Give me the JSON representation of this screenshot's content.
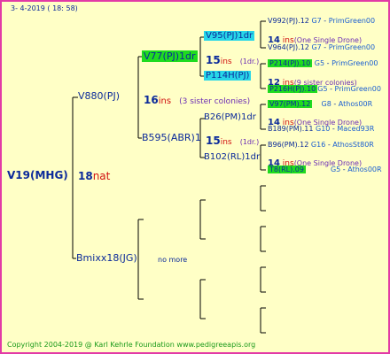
{
  "header": {
    "date": "3-  4-2019  ( 18: 58)"
  },
  "root": {
    "name": "V19(MHG)",
    "gen": "18",
    "unit": "nat"
  },
  "gen1": {
    "sire": "V880(PJ)",
    "sire_gen": "16",
    "sire_unit": "ins",
    "sire_note": "(3 sister colonies)",
    "dam": "Bmixx18(JG)",
    "dam_note": "no more"
  },
  "gen2": {
    "a": {
      "name": "V77(PJ)1dr",
      "gen": "15",
      "unit": "ins",
      "note": "(1dr.)"
    },
    "b": {
      "name": "B595(ABR)1",
      "gen": "15",
      "unit": "ins",
      "note": "(1dr.)"
    }
  },
  "gen3": [
    {
      "name": "V95(PJ)1dr"
    },
    {
      "name": "P114H(PJ)"
    },
    {
      "name": "B26(PM)1dr"
    },
    {
      "name": "B102(RL)1dr"
    }
  ],
  "gen4": [
    {
      "name": "V992(PJ).12",
      "gen": "G7",
      "loc": "PrimGreen00"
    },
    {
      "name": "V964(PJ).12",
      "gen": "G7",
      "loc": "PrimGreen00"
    },
    {
      "name": "P214(PJ).10",
      "gen": "G5",
      "loc": "PrimGreen00"
    },
    {
      "name": "P216H(PJ).10",
      "gen": "G5",
      "loc": "PrimGreen00"
    },
    {
      "name": "V97(PM).12",
      "gen": "G8",
      "loc": "Athos00R"
    },
    {
      "name": "B189(PM).11",
      "gen": "G10",
      "loc": "Maced93R"
    },
    {
      "name": "B96(PM).12",
      "gen": "G16",
      "loc": "AthosSt80R"
    },
    {
      "name": "T8(RL).09",
      "gen": "G5",
      "loc": "Athos00R"
    }
  ],
  "gen4info": [
    {
      "gen": "14",
      "unit": " ins",
      "note": "(One Single Drone)"
    },
    {
      "gen": "12",
      "unit": " ins",
      "note": "(9 sister colonies)"
    },
    {
      "gen": "14",
      "unit": " ins",
      "note": "(One Single Drone)"
    },
    {
      "gen": "14",
      "unit": " ins",
      "note": "(One Single Drone)"
    }
  ],
  "footer": {
    "copyright": "Copyright 2004-2019 @ Karl Kehrle Foundation    www.pedigreeapis.org"
  }
}
